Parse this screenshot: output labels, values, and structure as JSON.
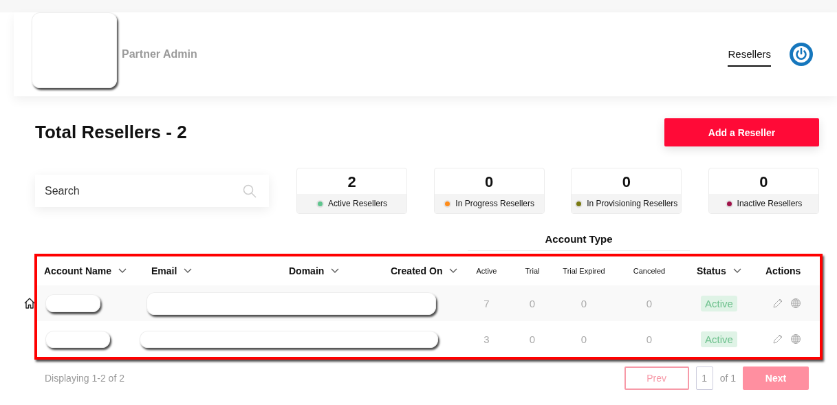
{
  "header": {
    "brand": "Partner Admin",
    "nav": [
      {
        "label": "Resellers",
        "selected": true
      }
    ]
  },
  "title": "Total Resellers - 2",
  "add_button": "Add a Reseller",
  "search": {
    "placeholder": "Search"
  },
  "stats": [
    {
      "value": "2",
      "label": "Active Resellers",
      "color": "#5fc58e"
    },
    {
      "value": "0",
      "label": "In Progress Resellers",
      "color": "#ff8c1a"
    },
    {
      "value": "0",
      "label": "In Provisioning Resellers",
      "color": "#7a7a12"
    },
    {
      "value": "0",
      "label": "Inactive Resellers",
      "color": "#a0134a"
    }
  ],
  "table": {
    "group_heading": "Account Type",
    "columns": [
      {
        "label": "Account Name",
        "sortable": true,
        "kind": "main"
      },
      {
        "label": "Email",
        "sortable": true,
        "kind": "main"
      },
      {
        "label": "Domain",
        "sortable": true,
        "kind": "main"
      },
      {
        "label": "Created On",
        "sortable": true,
        "kind": "main"
      },
      {
        "label": "Active",
        "sortable": false,
        "kind": "sub"
      },
      {
        "label": "Trial",
        "sortable": false,
        "kind": "sub"
      },
      {
        "label": "Trial Expired",
        "sortable": false,
        "kind": "sub"
      },
      {
        "label": "Canceled",
        "sortable": false,
        "kind": "sub"
      },
      {
        "label": "Status",
        "sortable": true,
        "kind": "main"
      },
      {
        "label": "Actions",
        "sortable": false,
        "kind": "main"
      }
    ],
    "rows": [
      {
        "active": "7",
        "trial": "0",
        "trial_expired": "0",
        "canceled": "0",
        "status": "Active",
        "home": true
      },
      {
        "active": "3",
        "trial": "0",
        "trial_expired": "0",
        "canceled": "0",
        "status": "Active",
        "home": false
      }
    ]
  },
  "footer": {
    "summary": "Displaying 1-2 of 2",
    "prev": {
      "label": "Prev",
      "disabled": true
    },
    "page": "1",
    "of": "of 1",
    "next": {
      "label": "Next",
      "disabled": true
    }
  }
}
